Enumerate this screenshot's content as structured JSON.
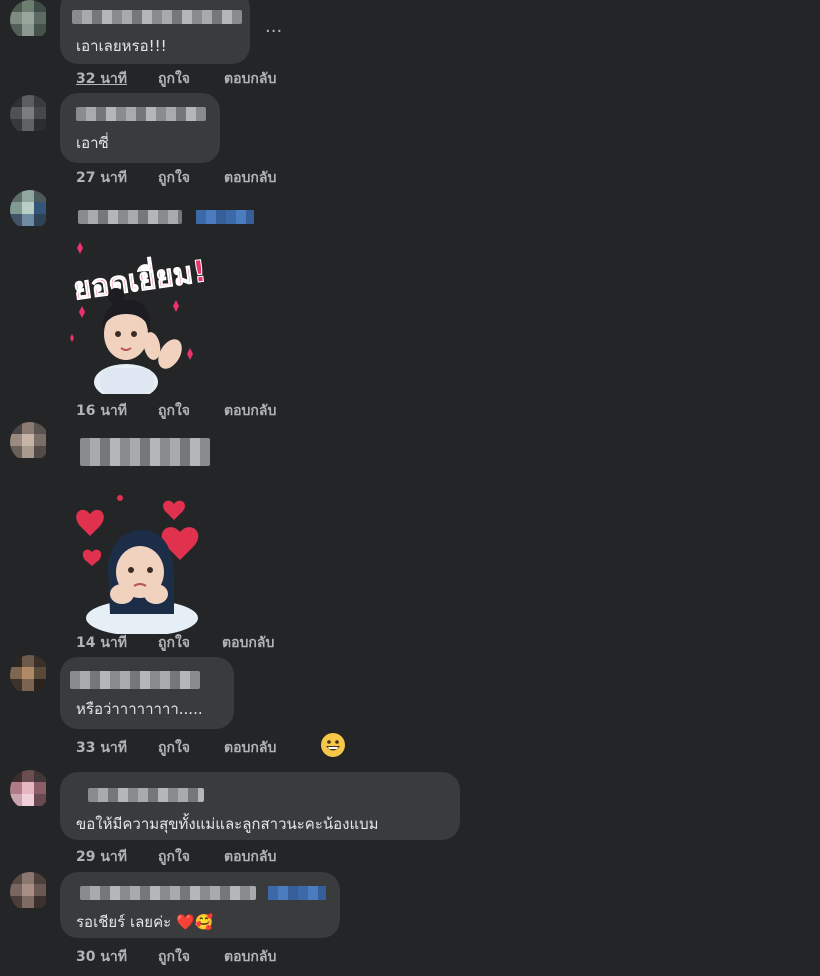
{
  "actions": {
    "like": "ถูกใจ",
    "reply": "ตอบกลับ",
    "more": "..."
  },
  "comments": [
    {
      "text": "เอาเลยหรอ!!!",
      "time": "32 นาที"
    },
    {
      "text": "เอาซี่",
      "time": "27 นาที"
    },
    {
      "sticker_text": "ยอดเยี่ยม!",
      "time": "16 นาที"
    },
    {
      "time": "14 นาที"
    },
    {
      "text": "หรือว่าาาาาาาา.....",
      "time": "33 นาที"
    },
    {
      "text": "ขอให้มีความสุขทั้งแม่และลูกสาวนะคะน้องแบม",
      "time": "29 นาที"
    },
    {
      "text": "รอเชียร์ เลยค่ะ ❤️🥰",
      "time": "30 นาที"
    }
  ],
  "colors": {
    "background": "#242526",
    "bubble": "#3a3b3c",
    "text": "#e4e6eb",
    "meta": "#b0b3b8",
    "sticker_pink": "#e8336b"
  }
}
